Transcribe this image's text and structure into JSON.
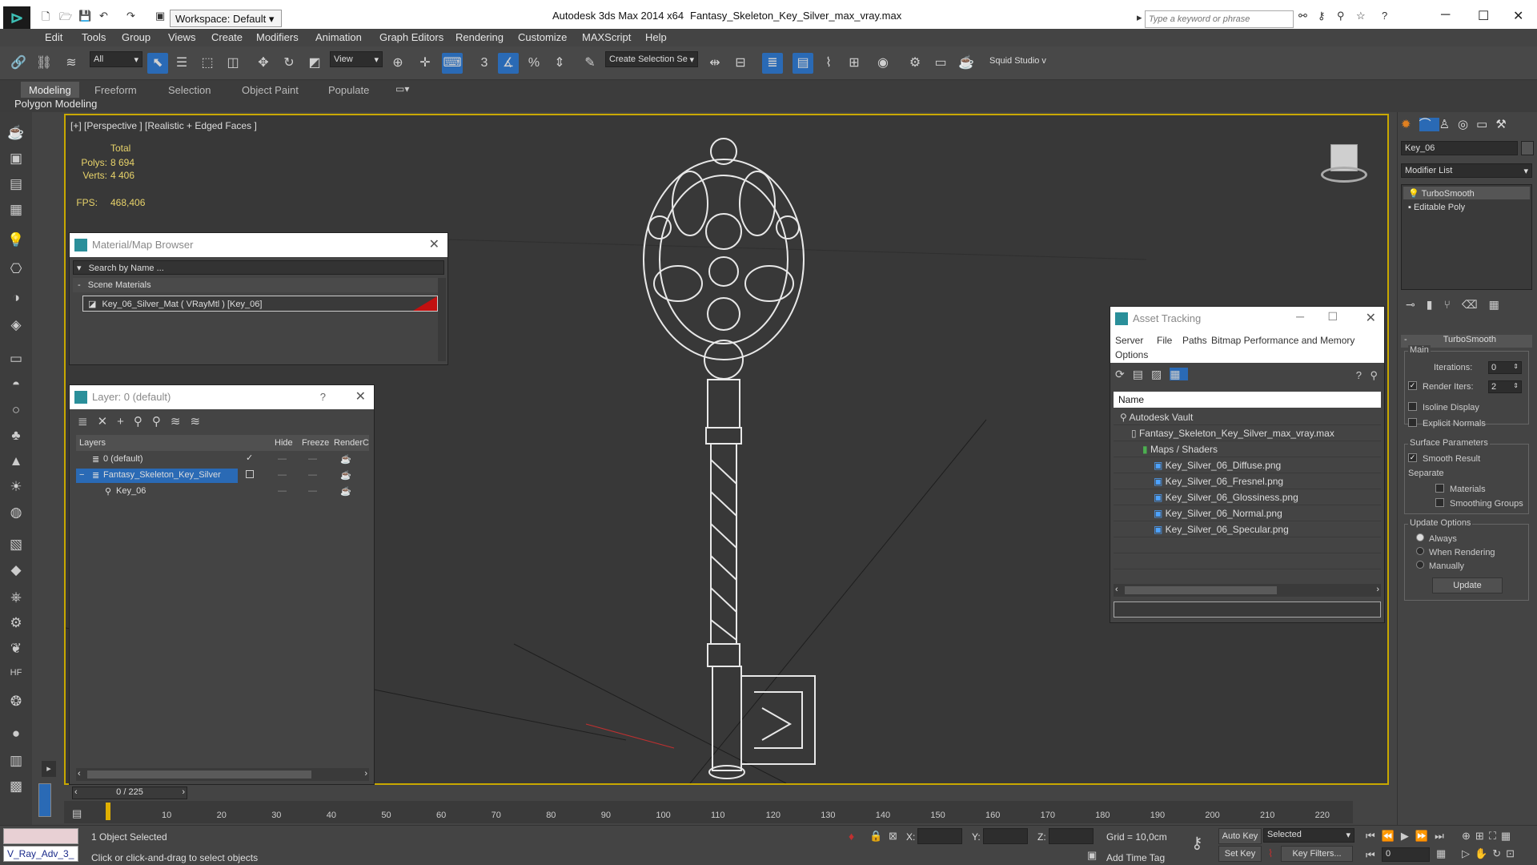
{
  "titlebar": {
    "workspace": "Workspace: Default",
    "app": "Autodesk 3ds Max  2014 x64",
    "file": "Fantasy_Skeleton_Key_Silver_max_vray.max",
    "search_placeholder": "Type a keyword or phrase"
  },
  "menu": [
    "Edit",
    "Tools",
    "Group",
    "Views",
    "Create",
    "Modifiers",
    "Animation",
    "Graph Editors",
    "Rendering",
    "Customize",
    "MAXScript",
    "Help"
  ],
  "toolbar": {
    "filter": "All",
    "refcoord": "View",
    "selection_set": "Create Selection Se",
    "studio": "Squid Studio v"
  },
  "ribbon": {
    "tabs": [
      "Modeling",
      "Freeform",
      "Selection",
      "Object Paint",
      "Populate"
    ],
    "subtab": "Polygon Modeling"
  },
  "viewport": {
    "label": "[+] [Perspective ] [Realistic + Edged Faces ]",
    "total": "Total",
    "polys_label": "Polys:",
    "polys": "8 694",
    "verts_label": "Verts:",
    "verts": "4 406",
    "fps_label": "FPS:",
    "fps": "468,406"
  },
  "material_browser": {
    "title": "Material/Map Browser",
    "search": "Search by Name ...",
    "section": "Scene Materials",
    "item": "Key_06_Silver_Mat  ( VRayMtl ) [Key_06]"
  },
  "layer_manager": {
    "title": "Layer: 0 (default)",
    "help": "?",
    "columns": [
      "Layers",
      "Hide",
      "Freeze",
      "Render",
      "C"
    ],
    "rows": [
      {
        "name": "0 (default)"
      },
      {
        "name": "Fantasy_Skeleton_Key_Silver"
      },
      {
        "name": "Key_06"
      }
    ]
  },
  "asset_tracking": {
    "title": "Asset Tracking",
    "menu": [
      "Server",
      "File",
      "Paths",
      "Bitmap Performance and Memory",
      "Options"
    ],
    "column": "Name",
    "items": [
      {
        "name": "Autodesk Vault",
        "level": 0
      },
      {
        "name": "Fantasy_Skeleton_Key_Silver_max_vray.max",
        "level": 1
      },
      {
        "name": "Maps / Shaders",
        "level": 2
      },
      {
        "name": "Key_Silver_06_Diffuse.png",
        "level": 3
      },
      {
        "name": "Key_Silver_06_Fresnel.png",
        "level": 3
      },
      {
        "name": "Key_Silver_06_Glossiness.png",
        "level": 3
      },
      {
        "name": "Key_Silver_06_Normal.png",
        "level": 3
      },
      {
        "name": "Key_Silver_06_Specular.png",
        "level": 3
      }
    ]
  },
  "command_panel": {
    "object_name": "Key_06",
    "modifier_list": "Modifier List",
    "stack": [
      "TurboSmooth",
      "Editable Poly"
    ],
    "rollout": "TurboSmooth",
    "main": "Main",
    "iterations_label": "Iterations:",
    "iterations": "0",
    "render_iters_label": "Render Iters:",
    "render_iters": "2",
    "isoline": "Isoline Display",
    "explicit": "Explicit Normals",
    "surface": "Surface Parameters",
    "smooth_result": "Smooth Result",
    "separate": "Separate",
    "materials": "Materials",
    "smoothing_groups": "Smoothing Groups",
    "update_options": "Update Options",
    "always": "Always",
    "when_rendering": "When Rendering",
    "manually": "Manually",
    "update": "Update"
  },
  "timeline": {
    "frame": "0 / 225",
    "ticks": [
      "10",
      "20",
      "30",
      "40",
      "50",
      "60",
      "70",
      "80",
      "90",
      "100",
      "110",
      "120",
      "130",
      "140",
      "150",
      "160",
      "170",
      "180",
      "190",
      "200",
      "210",
      "220"
    ]
  },
  "status": {
    "maxscript": "V_Ray_Adv_3_",
    "selected": "1 Object Selected",
    "prompt": "Click or click-and-drag to select objects",
    "x_label": "X:",
    "y_label": "Y:",
    "z_label": "Z:",
    "grid": "Grid = 10,0cm",
    "add_time_tag": "Add Time Tag",
    "auto_key": "Auto Key",
    "set_key": "Set Key",
    "selected_set": "Selected",
    "key_filters": "Key Filters...",
    "frame_value": "0"
  }
}
